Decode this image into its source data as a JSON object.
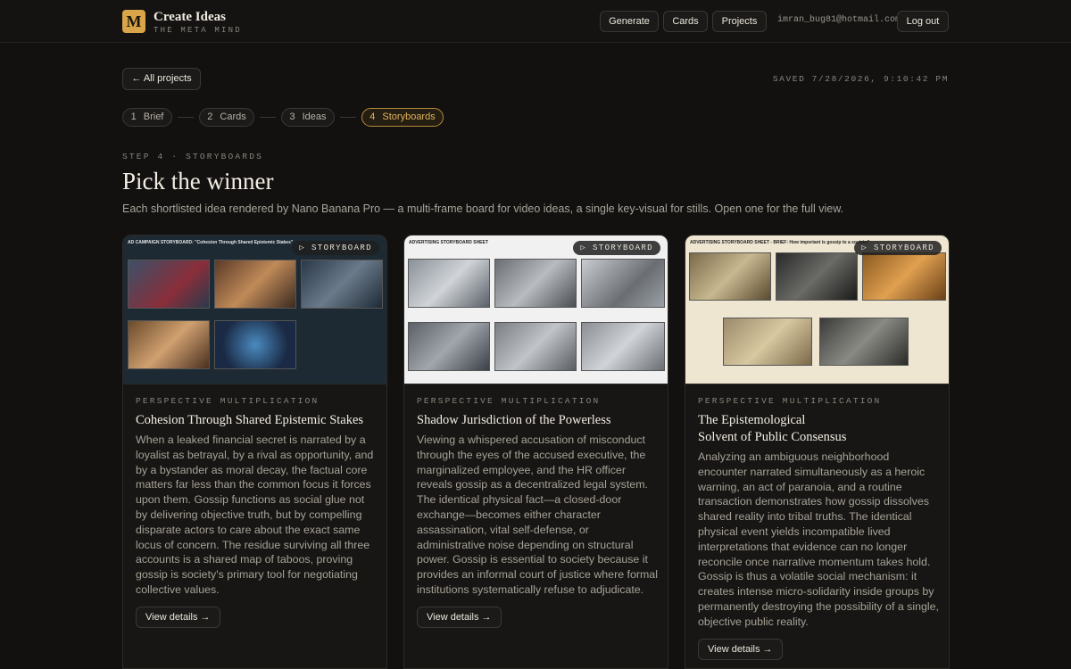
{
  "header": {
    "logo_letter": "M",
    "brand_title": "Create Ideas",
    "brand_subtitle": "THE META MIND",
    "nav": [
      "Generate",
      "Cards",
      "Projects"
    ],
    "user_email": "imran_bug81@hotmail.com",
    "logout_label": "Log out"
  },
  "toolbar": {
    "back_label": "← All projects",
    "saved_label": "SAVED 7/28/2026, 9:10:42 PM"
  },
  "steps": [
    {
      "num": "1",
      "label": "Brief"
    },
    {
      "num": "2",
      "label": "Cards"
    },
    {
      "num": "3",
      "label": "Ideas"
    },
    {
      "num": "4",
      "label": "Storyboards"
    }
  ],
  "page": {
    "eyebrow": "STEP 4 · STORYBOARDS",
    "title": "Pick the winner",
    "description": "Each shortlisted idea rendered by Nano Banana Pro — a multi-frame board for video ideas, a single key-visual for stills. Open one for the full view."
  },
  "cards": [
    {
      "badge": "▷ STORYBOARD",
      "tag": "PERSPECTIVE MULTIPLICATION",
      "title": "Cohesion Through Shared Epistemic Stakes",
      "text": "When a leaked financial secret is narrated by a loyalist as betrayal, by a rival as opportunity, and by a bystander as moral decay, the factual core matters far less than the common focus it forces upon them. Gossip functions as social glue not by delivering objective truth, but by compelling disparate actors to care about the exact same locus of concern. The residue surviving all three accounts is a shared map of taboos, proving gossip is society's primary tool for negotiating collective values.",
      "button": "View details →",
      "board_heading": "AD CAMPAIGN STORYBOARD: \"Cohesion Through Shared Epistemic Stakes\""
    },
    {
      "badge": "▷ STORYBOARD",
      "tag": "PERSPECTIVE MULTIPLICATION",
      "title": "Shadow Jurisdiction of the Powerless",
      "text": "Viewing a whispered accusation of misconduct through the eyes of the accused executive, the marginalized employee, and the HR officer reveals gossip as a decentralized legal system. The identical physical fact—a closed-door exchange—becomes either character assassination, vital self-defense, or administrative noise depending on structural power. Gossip is essential to society because it provides an informal court of justice where formal institutions systematically refuse to adjudicate.",
      "button": "View details →",
      "board_heading": "ADVERTISING STORYBOARD SHEET"
    },
    {
      "badge": "▷ STORYBOARD",
      "tag": "PERSPECTIVE MULTIPLICATION",
      "title": "The Epistemological\nSolvent of Public Consensus",
      "text": "Analyzing an ambiguous neighborhood encounter narrated simultaneously as a heroic warning, an act of paranoia, and a routine transaction demonstrates how gossip dissolves shared reality into tribal truths. The identical physical event yields incompatible lived interpretations that evidence can no longer reconcile once narrative momentum takes hold. Gossip is thus a volatile social mechanism: it creates intense micro-solidarity inside groups by permanently destroying the possibility of a single, objective public reality.",
      "button": "View details →",
      "board_heading": "ADVERTISING STORYBOARD SHEET - BRIEF: How important is gossip to a society?"
    }
  ]
}
